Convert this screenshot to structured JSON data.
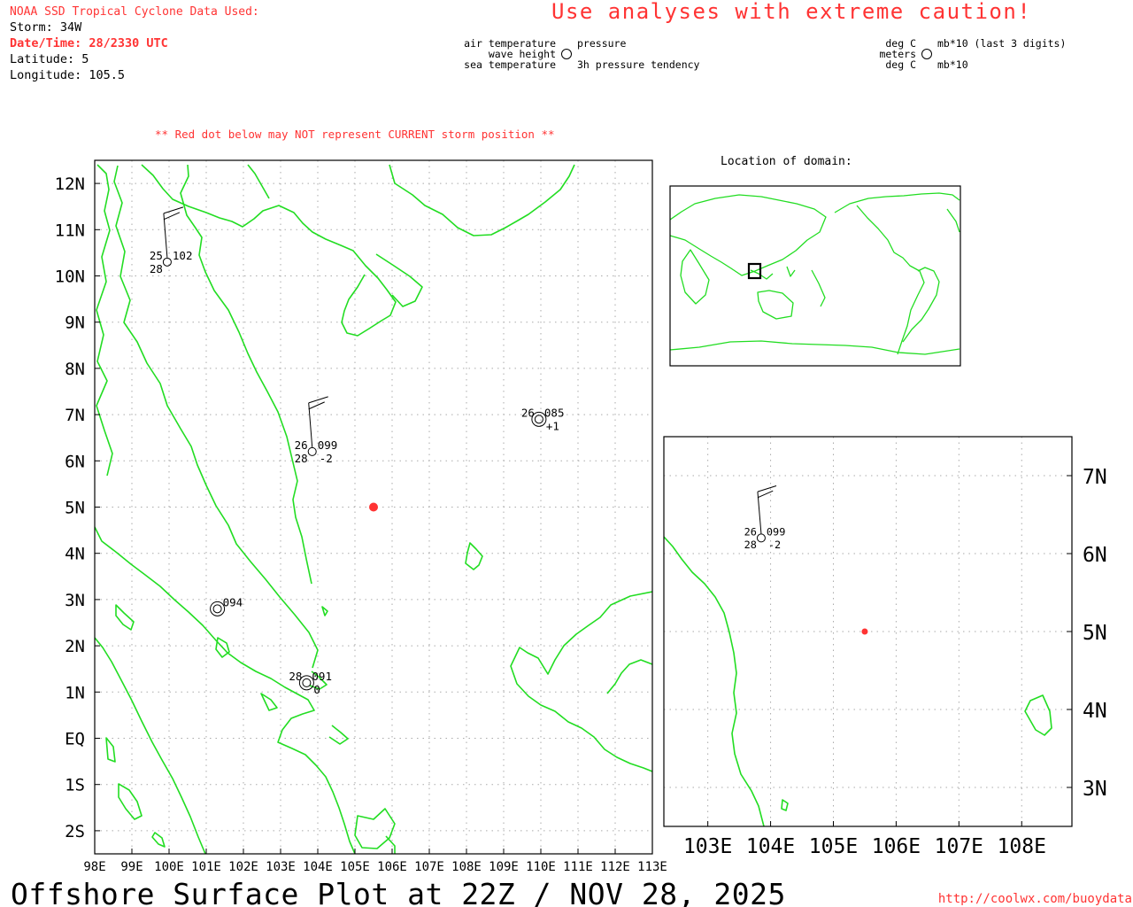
{
  "header": {
    "source_label": "NOAA SSD Tropical Cyclone Data Used:",
    "storm": "Storm: 34W",
    "datetime": "Date/Time: 28/2330 UTC",
    "latitude": "Latitude: 5",
    "longitude": "Longitude: 105.5",
    "caution": "Use analyses with extreme caution!"
  },
  "legend": {
    "left_tl": "air temperature",
    "left_ml": "wave height",
    "left_bl": "sea temperature",
    "left_tr": "pressure",
    "left_br": "3h pressure tendency",
    "right_tl": "deg C",
    "right_ml": "meters",
    "right_bl": "deg C",
    "right_tr": "mb*10 (last 3 digits)",
    "right_br": "mb*10"
  },
  "warning": "** Red dot below may NOT represent CURRENT storm position **",
  "inset_title": "Location of domain:",
  "footer": {
    "title": "Offshore Surface Plot at 22Z / NOV 28, 2025",
    "url": "http://coolwx.com/buoydata"
  },
  "colors": {
    "coast": "#22dd22",
    "storm": "#ff3333",
    "warning": "#ff3333",
    "grid": "#aaaaaa",
    "ink": "#000000"
  },
  "main_map": {
    "lon_ticks": [
      "98E",
      "99E",
      "100E",
      "101E",
      "102E",
      "103E",
      "104E",
      "105E",
      "106E",
      "107E",
      "108E",
      "109E",
      "110E",
      "111E",
      "112E",
      "113E"
    ],
    "lat_ticks": [
      "12N",
      "11N",
      "10N",
      "9N",
      "8N",
      "7N",
      "6N",
      "5N",
      "4N",
      "3N",
      "2N",
      "1N",
      "EQ",
      "1S",
      "2S"
    ]
  },
  "zoom_map": {
    "lon_ticks": [
      "103E",
      "104E",
      "105E",
      "106E",
      "107E",
      "108E"
    ],
    "lat_ticks": [
      "7N",
      "6N",
      "5N",
      "4N",
      "3N"
    ]
  },
  "storm_position": {
    "lat": 5,
    "lon": 105.5
  },
  "stations": [
    {
      "lon": 99.95,
      "lat": 10.3,
      "air_temp": "25",
      "pressure": "102",
      "sea_temp": "28",
      "tendency": "",
      "wind_barb": true
    },
    {
      "lon": 103.85,
      "lat": 6.2,
      "air_temp": "26",
      "pressure": "099",
      "sea_temp": "28",
      "tendency": "-2",
      "wind_barb": true
    },
    {
      "lon": 109.95,
      "lat": 6.9,
      "air_temp": "26",
      "pressure": "085",
      "sea_temp": "",
      "tendency": "+1",
      "wind_barb": false
    },
    {
      "lon": 101.3,
      "lat": 2.8,
      "air_temp": "",
      "pressure": "094",
      "sea_temp": "",
      "tendency": "",
      "wind_barb": false
    },
    {
      "lon": 103.7,
      "lat": 1.2,
      "air_temp": "28",
      "pressure": "091",
      "sea_temp": "",
      "tendency": "0",
      "wind_barb": false
    }
  ]
}
